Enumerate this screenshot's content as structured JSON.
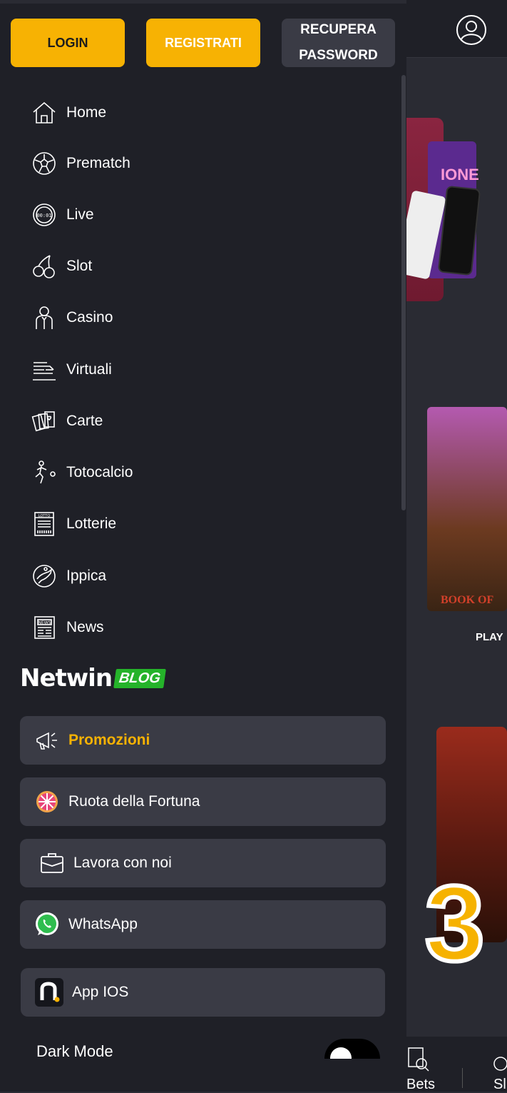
{
  "header": {
    "login_label": "LOGIN",
    "register_label": "REGISTRATI",
    "recover_line1": "RECUPERA",
    "recover_line2": "PASSWORD"
  },
  "menu": {
    "items": [
      {
        "label": "Home",
        "icon": "home-icon"
      },
      {
        "label": "Prematch",
        "icon": "soccer-ball-icon"
      },
      {
        "label": "Live",
        "icon": "live-timer-icon"
      },
      {
        "label": "Slot",
        "icon": "cherries-icon"
      },
      {
        "label": "Casino",
        "icon": "croupier-icon"
      },
      {
        "label": "Virtuali",
        "icon": "virtual-track-icon"
      },
      {
        "label": "Carte",
        "icon": "playing-cards-icon"
      },
      {
        "label": "Totocalcio",
        "icon": "football-player-icon"
      },
      {
        "label": "Lotterie",
        "icon": "lotto-ticket-icon"
      },
      {
        "label": "Ippica",
        "icon": "horse-racing-icon"
      },
      {
        "label": "News",
        "icon": "newspaper-icon"
      }
    ]
  },
  "blog": {
    "brand": "Netwin",
    "tag": "BLOG"
  },
  "panels": [
    {
      "label": "Promozioni",
      "icon": "megaphone-icon"
    },
    {
      "label": "Ruota della Fortuna",
      "icon": "fortune-wheel-icon"
    },
    {
      "label": "Lavora con noi",
      "icon": "briefcase-icon"
    },
    {
      "label": "WhatsApp",
      "icon": "whatsapp-icon"
    },
    {
      "label": "App IOS",
      "icon": "netwin-app-icon"
    }
  ],
  "dark_mode": {
    "label": "Dark Mode",
    "enabled": true
  },
  "background": {
    "promo_fragment": "IONE",
    "game_fragment": "BOOK OF",
    "play_fragment": "PLAY",
    "big_number": "3",
    "bottom_nav": [
      "Bets",
      "Sl"
    ]
  },
  "colors": {
    "accent": "#f7b203",
    "panel": "#3a3b45",
    "drawer": "#1f2027",
    "blog_green": "#25b32a"
  }
}
